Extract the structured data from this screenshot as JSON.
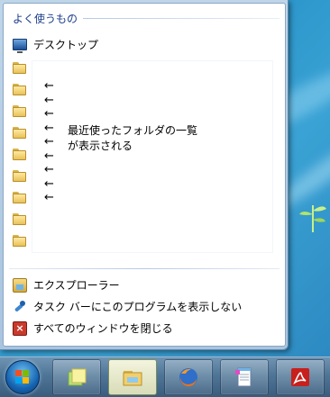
{
  "jump_list": {
    "section_title": "よく使うもの",
    "pinned": [
      {
        "label": "デスクトップ",
        "icon": "desktop-icon"
      }
    ],
    "recent_folder_count": 9,
    "arrows": [
      "←",
      "←",
      "←",
      "←",
      "←",
      "←",
      "←",
      "←",
      "←"
    ],
    "callout_line1": "最近使ったフォルダの一覧",
    "callout_line2": "が表示される",
    "tasks": [
      {
        "label": "エクスプローラー",
        "icon": "explorer-icon"
      },
      {
        "label": "タスク バーにこのプログラムを表示しない",
        "icon": "unpin-icon"
      },
      {
        "label": "すべてのウィンドウを閉じる",
        "icon": "close-window-icon"
      }
    ]
  },
  "taskbar": {
    "buttons": [
      {
        "name": "start-button",
        "icon": "windows-start-icon"
      },
      {
        "name": "sticky-notes",
        "icon": "sticky-notes-icon"
      },
      {
        "name": "windows-explorer",
        "icon": "folder-icon",
        "active": true
      },
      {
        "name": "firefox",
        "icon": "firefox-icon"
      },
      {
        "name": "notepad",
        "icon": "notepad-icon"
      },
      {
        "name": "acrobat",
        "icon": "acrobat-icon"
      }
    ]
  },
  "colors": {
    "section_title": "#1e3e8c",
    "taskbar": "#4f7596",
    "desktop": "#2a94c9"
  }
}
